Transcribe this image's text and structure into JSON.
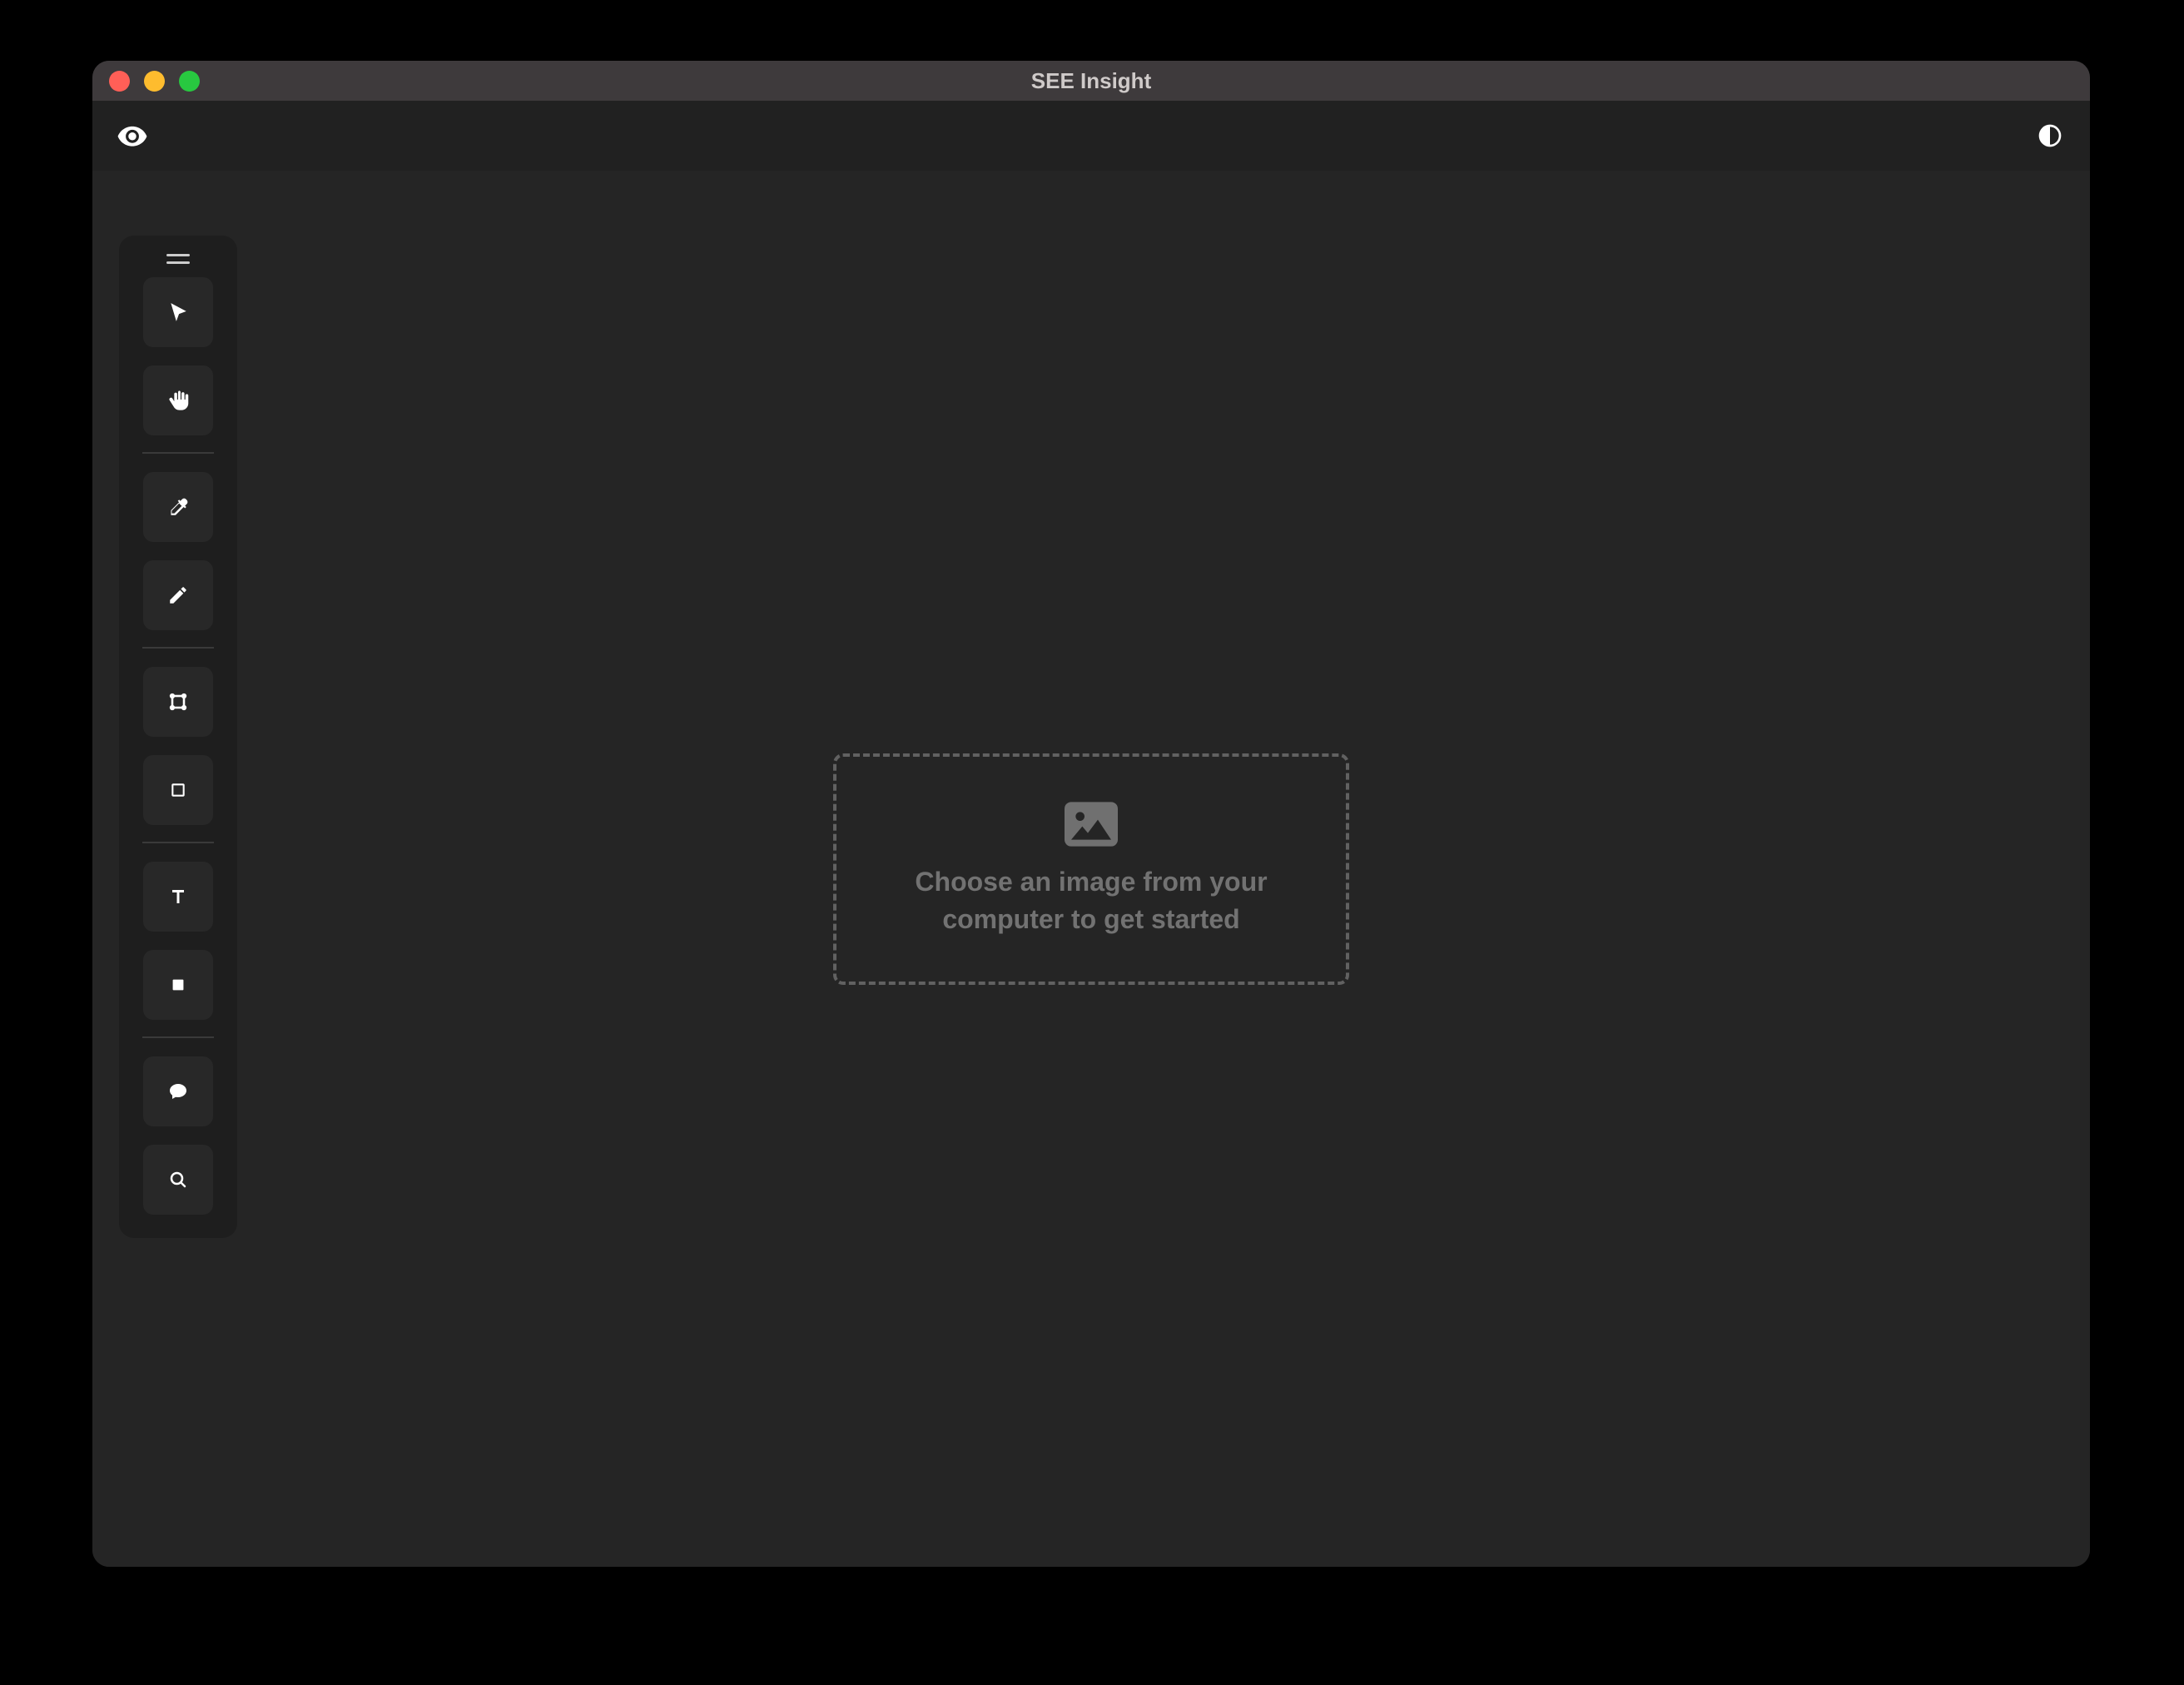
{
  "window": {
    "title": "SEE Insight"
  },
  "topbar": {
    "left_icon": "eye-icon",
    "right_icon": "contrast-icon"
  },
  "toolbox": {
    "handle": "drag-handle-icon",
    "groups": [
      [
        "cursor-icon",
        "hand-icon"
      ],
      [
        "eyedropper-icon",
        "pencil-icon"
      ],
      [
        "crop-icon",
        "rectangle-outline-icon"
      ],
      [
        "text-icon",
        "stop-square-icon"
      ],
      [
        "comment-icon",
        "search-icon"
      ]
    ]
  },
  "dropzone": {
    "icon": "image-icon",
    "text": "Choose an image from your computer to get started"
  }
}
